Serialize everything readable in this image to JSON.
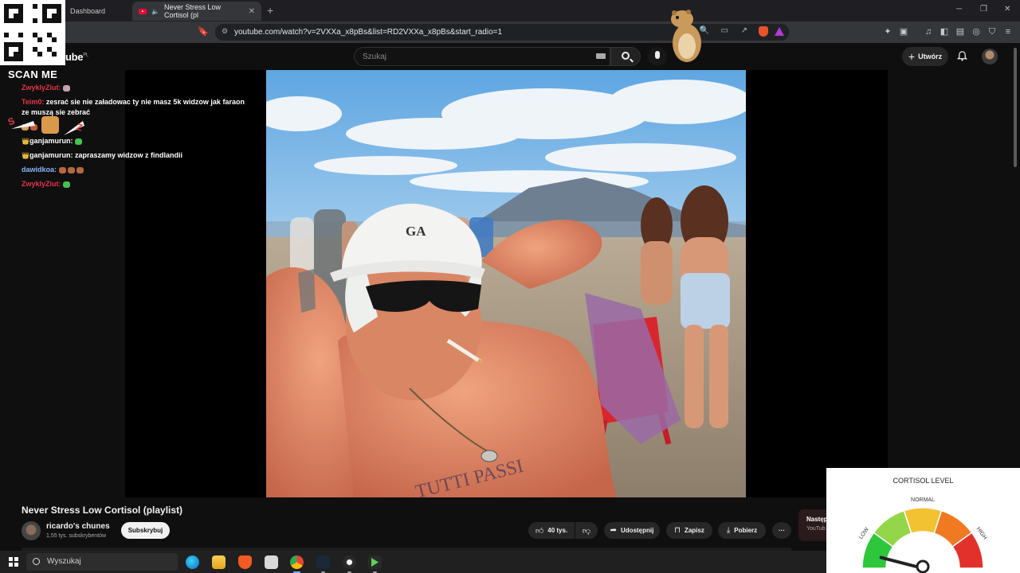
{
  "browser": {
    "tabs": [
      {
        "label": "Dashboard"
      },
      {
        "label": "Never Stress Low Cortisol (pl"
      }
    ],
    "new_tab": "+",
    "url": "youtube.com/watch?v=2VXXa_x8pBs&list=RD2VXXa_x8pBs&start_radio=1",
    "window_controls": {
      "minimize": "─",
      "restore": "❐",
      "close": "✕"
    }
  },
  "youtube": {
    "logo": "ube",
    "region": "PL",
    "search_placeholder": "Szukaj",
    "create_label": "Utwórz"
  },
  "overlay": {
    "qr_label": "SCAN ME",
    "chat": [
      {
        "user": "ZwyklyZiut:",
        "message": "",
        "user_color": "#e8324c",
        "emotes": [
          "#c9a0b0"
        ]
      },
      {
        "user": "Teim0:",
        "message": "zesrać sie nie załadowac ty nie masz 5k widzow jak faraon ze muszą sie zebrać",
        "user_color": "#e8324c",
        "emotes": []
      },
      {
        "user": "",
        "message": "",
        "user_color": "#ffffff",
        "emotes": [
          "#d9a25c",
          "#c05a3a"
        ]
      },
      {
        "user": "ganjamurun:",
        "message": "",
        "user_color": "#ffffff",
        "crown": "👑",
        "emotes": [
          "#46c24e"
        ]
      },
      {
        "user": "ganjamurun:",
        "message": "zapraszamy widzow z findlandii",
        "user_color": "#ffffff",
        "crown": "👑",
        "emotes": []
      },
      {
        "user": "dawidkoa:",
        "message": "",
        "user_color": "#8ab4f8",
        "emotes": [
          "#b5683c",
          "#b5683c",
          "#b5683c"
        ]
      },
      {
        "user": "ZwyklyZiut:",
        "message": "",
        "user_color": "#e8324c",
        "emotes": [
          "#46c24e"
        ]
      }
    ]
  },
  "video": {
    "title": "Never Stress Low Cortisol (playlist)",
    "hat_text": "GA",
    "tattoo_text": "TUTTI PASSI",
    "channel_name": "ricardo's chunes",
    "subscribers": "1,55 tys. subskrybentów",
    "subscribe_label": "Subskrybuj",
    "likes": "40 tys.",
    "share_label": "Udostępnij",
    "save_label": "Zapisz",
    "download_label": "Pobierz",
    "more_label": "···"
  },
  "next_card": {
    "title": "Następ",
    "channel": "YouTub"
  },
  "gauge": {
    "title": "CORTISOL LEVEL",
    "labels": [
      "LOW",
      "NORMAL",
      "HIGH"
    ],
    "zone_colors": [
      "#2ec63b",
      "#93d64a",
      "#f2c232",
      "#f07a22",
      "#e2312b"
    ],
    "level_fraction": 0.08
  },
  "taskbar": {
    "search_placeholder": "Wyszukaj",
    "apps": [
      "edge-icon",
      "file-explorer-icon",
      "brave-icon",
      "app-icon",
      "chrome-icon",
      "steam-icon",
      "obs-icon",
      "terminal-icon"
    ]
  }
}
